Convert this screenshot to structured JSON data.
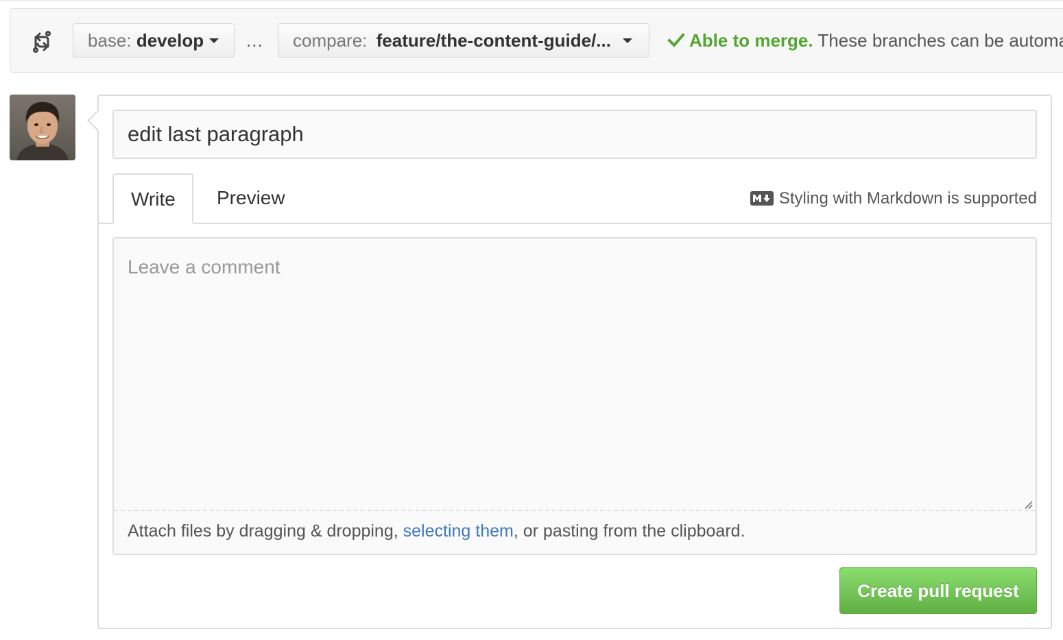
{
  "range": {
    "icon": "git-compare-icon",
    "base_prefix": "base:",
    "base_branch": "develop",
    "dots": "...",
    "compare_prefix": "compare:",
    "compare_branch": "feature/the-content-guide/...",
    "merge_icon": "check-icon",
    "merge_status": "Able to merge.",
    "merge_description": "These branches can be automa"
  },
  "avatar": {
    "alt": "author avatar"
  },
  "composer": {
    "title_value": "edit last paragraph",
    "tabs": [
      {
        "label": "Write",
        "selected": true
      },
      {
        "label": "Preview",
        "selected": false
      }
    ],
    "markdown_icon": "markdown-icon",
    "markdown_note": "Styling with Markdown is supported",
    "comment_placeholder": "Leave a comment",
    "attach": {
      "before": "Attach files by dragging & dropping, ",
      "link": "selecting them",
      "after": ", or pasting from the clipboard."
    },
    "submit_label": "Create pull request"
  },
  "colors": {
    "success_green": "#55a532",
    "link_blue": "#4078c0",
    "button_green": "#60b044"
  }
}
